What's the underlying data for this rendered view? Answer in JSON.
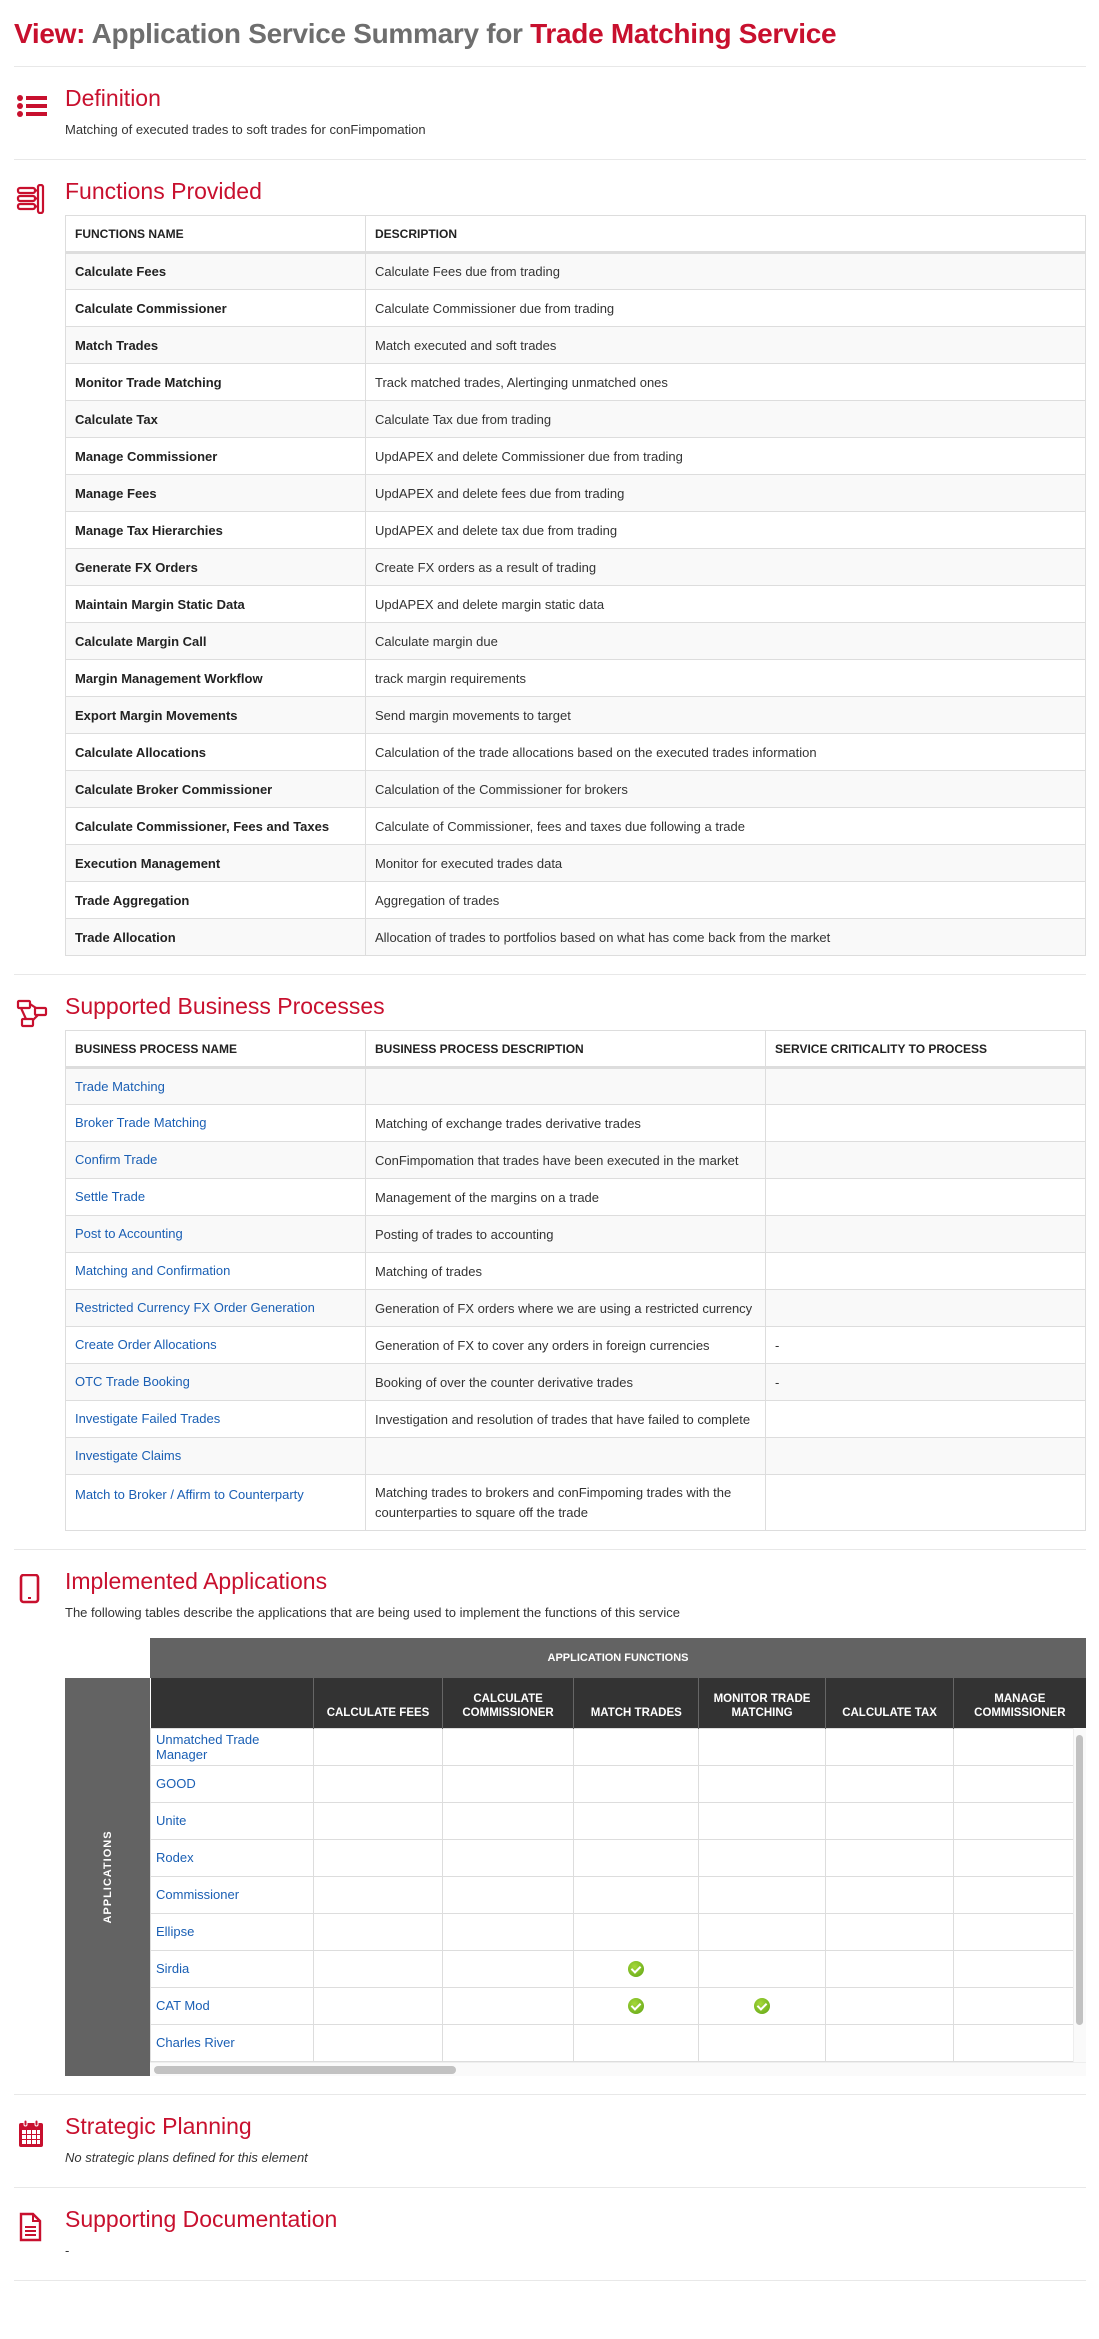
{
  "header": {
    "prefix": "View:",
    "middle": "Application Service Summary for",
    "subject": "Trade Matching Service"
  },
  "colors": {
    "accent": "#c8102e",
    "link": "#1a5fb4",
    "check": "#6db320",
    "matrix_header": "#333333",
    "matrix_band": "#636363"
  },
  "definition": {
    "icon": "list-icon",
    "title": "Definition",
    "text": "Matching of executed trades to soft trades for conFimpomation"
  },
  "functions": {
    "icon": "functions-icon",
    "title": "Functions Provided",
    "columns": [
      "FUNCTIONS NAME",
      "DESCRIPTION"
    ],
    "rows": [
      {
        "name": "Calculate Fees",
        "description": "Calculate Fees due from trading"
      },
      {
        "name": "Calculate Commissioner",
        "description": "Calculate Commissioner due from trading"
      },
      {
        "name": "Match Trades",
        "description": "Match executed and soft trades"
      },
      {
        "name": "Monitor Trade Matching",
        "description": "Track matched trades, Alertinging unmatched ones"
      },
      {
        "name": "Calculate Tax",
        "description": "Calculate Tax due from trading"
      },
      {
        "name": "Manage Commissioner",
        "description": "UpdAPEX and delete Commissioner due from trading"
      },
      {
        "name": "Manage Fees",
        "description": "UpdAPEX and delete fees due from trading"
      },
      {
        "name": "Manage Tax Hierarchies",
        "description": "UpdAPEX and delete tax due from trading"
      },
      {
        "name": "Generate FX Orders",
        "description": "Create FX orders as a result of trading"
      },
      {
        "name": "Maintain Margin Static Data",
        "description": "UpdAPEX and delete margin static data"
      },
      {
        "name": "Calculate Margin Call",
        "description": "Calculate margin due"
      },
      {
        "name": "Margin Management Workflow",
        "description": "track margin requirements"
      },
      {
        "name": "Export Margin Movements",
        "description": "Send margin movements to target"
      },
      {
        "name": "Calculate Allocations",
        "description": "Calculation of the trade allocations based on the executed trades information"
      },
      {
        "name": "Calculate Broker Commissioner",
        "description": "Calculation of the Commissioner for brokers"
      },
      {
        "name": "Calculate Commissioner, Fees and Taxes",
        "description": "Calculate of Commissioner, fees and taxes due following a trade"
      },
      {
        "name": "Execution Management",
        "description": "Monitor for executed trades data"
      },
      {
        "name": "Trade Aggregation",
        "description": "Aggregation of trades"
      },
      {
        "name": "Trade Allocation",
        "description": "Allocation of trades to portfolios based on what has come back from the market"
      }
    ]
  },
  "processes": {
    "icon": "process-flow-icon",
    "title": "Supported Business Processes",
    "columns": [
      "BUSINESS PROCESS NAME",
      "BUSINESS PROCESS DESCRIPTION",
      "SERVICE CRITICALITY TO PROCESS"
    ],
    "rows": [
      {
        "name": "Trade Matching",
        "description": "",
        "criticality": ""
      },
      {
        "name": "Broker Trade Matching",
        "description": "Matching of exchange trades derivative trades",
        "criticality": ""
      },
      {
        "name": "Confirm Trade",
        "description": "ConFimpomation that trades have been executed in the market",
        "criticality": ""
      },
      {
        "name": "Settle Trade",
        "description": "Management of the margins on a trade",
        "criticality": ""
      },
      {
        "name": "Post to Accounting",
        "description": "Posting of trades to accounting",
        "criticality": ""
      },
      {
        "name": "Matching and Confirmation",
        "description": "Matching of trades",
        "criticality": ""
      },
      {
        "name": "Restricted Currency FX Order Generation",
        "description": "Generation of FX orders where we are using a restricted currency",
        "criticality": ""
      },
      {
        "name": "Create Order Allocations",
        "description": "Generation of FX to cover any orders in foreign currencies",
        "criticality": "-"
      },
      {
        "name": "OTC Trade Booking",
        "description": "Booking of over the counter derivative trades",
        "criticality": "-"
      },
      {
        "name": "Investigate Failed Trades",
        "description": "Investigation and resolution of trades that have failed to complete",
        "criticality": ""
      },
      {
        "name": "Investigate Claims",
        "description": "",
        "criticality": ""
      },
      {
        "name": "Match to Broker / Affirm to Counterparty",
        "description": "Matching trades to brokers and conFimpoming trades with the counterparties to square off the trade",
        "criticality": ""
      }
    ]
  },
  "applications": {
    "icon": "tablet-icon",
    "title": "Implemented Applications",
    "intro": "The following tables describe the applications that are being used to implement the functions of this service",
    "band_label": "APPLICATION FUNCTIONS",
    "side_label": "APPLICATIONS",
    "function_columns": [
      "CALCULATE FEES",
      "CALCULATE COMMISSIONER",
      "MATCH TRADES",
      "MONITOR TRADE MATCHING",
      "CALCULATE TAX",
      "MANAGE COMMISSIONER"
    ],
    "rows": [
      {
        "name": "Unmatched Trade Manager",
        "checks": [
          false,
          false,
          false,
          false,
          false,
          false
        ]
      },
      {
        "name": "GOOD",
        "checks": [
          false,
          false,
          false,
          false,
          false,
          false
        ]
      },
      {
        "name": "Unite",
        "checks": [
          false,
          false,
          false,
          false,
          false,
          false
        ]
      },
      {
        "name": "Rodex",
        "checks": [
          false,
          false,
          false,
          false,
          false,
          false
        ]
      },
      {
        "name": "Commissioner",
        "checks": [
          false,
          false,
          false,
          false,
          false,
          false
        ]
      },
      {
        "name": "Ellipse",
        "checks": [
          false,
          false,
          false,
          false,
          false,
          false
        ]
      },
      {
        "name": "Sirdia",
        "checks": [
          false,
          false,
          true,
          false,
          false,
          false
        ]
      },
      {
        "name": "CAT Mod",
        "checks": [
          false,
          false,
          true,
          true,
          false,
          false
        ]
      },
      {
        "name": "Charles River",
        "checks": [
          false,
          false,
          false,
          false,
          false,
          false
        ]
      }
    ],
    "check_icon": "check-circle-icon"
  },
  "strategic": {
    "icon": "calendar-icon",
    "title": "Strategic Planning",
    "text": "No strategic plans defined for this element"
  },
  "documentation": {
    "icon": "document-icon",
    "title": "Supporting Documentation",
    "text": "-"
  }
}
